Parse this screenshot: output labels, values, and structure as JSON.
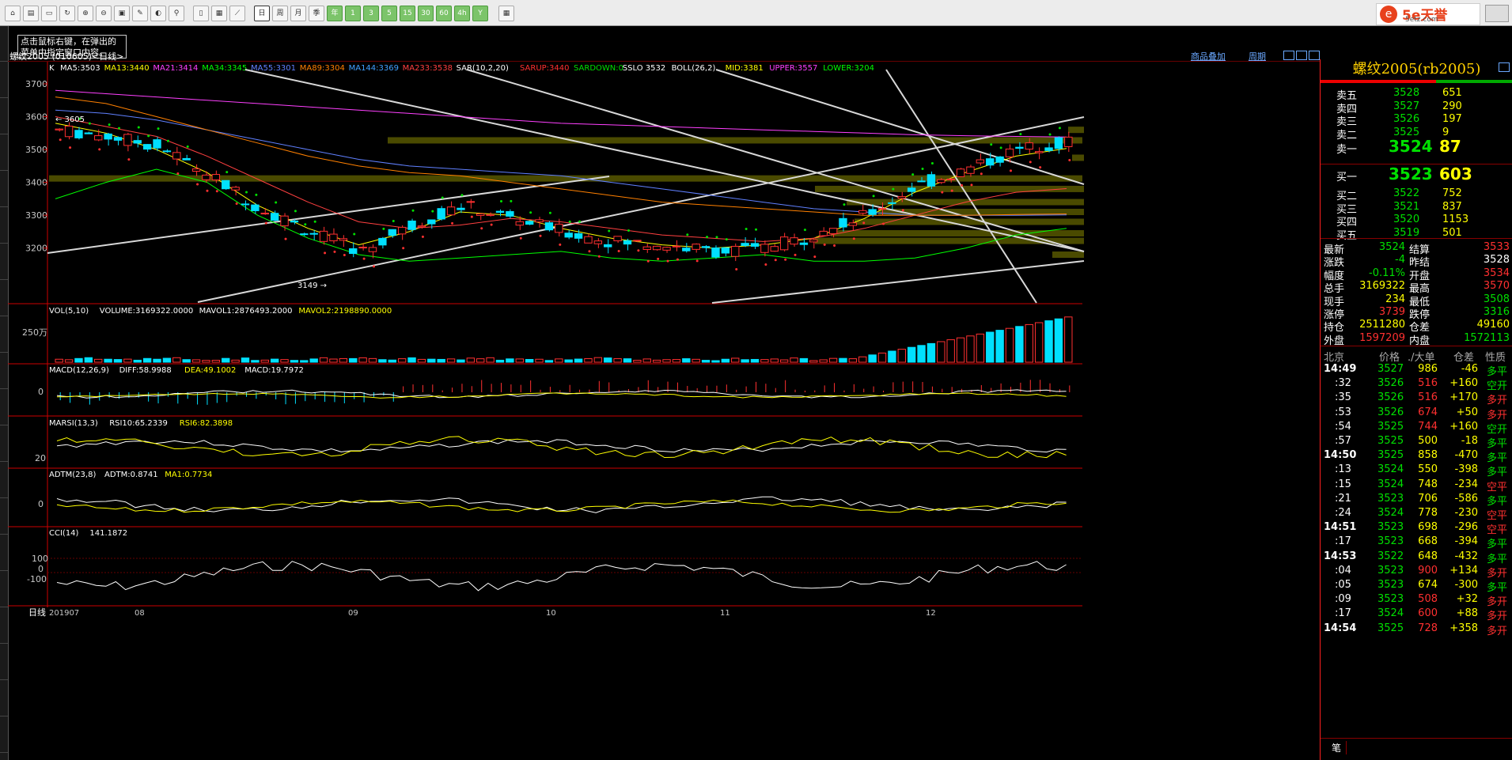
{
  "toolbar": {
    "buttons": [
      "home-icon",
      "open-icon",
      "folder-icon",
      "refresh-icon",
      "zoom-in-icon",
      "zoom-out-icon",
      "draw-icon",
      "pen-icon",
      "palette-icon",
      "filter-icon",
      "tick-icon",
      "table-icon",
      "line-chart-icon",
      "candle-icon",
      "day-icon",
      "week-icon",
      "month-icon",
      "season-icon",
      "year-icon",
      "1min",
      "3min",
      "5min",
      "15min",
      "30min",
      "60min",
      "4hour",
      "year2",
      "calendar-icon"
    ],
    "period_labels": [
      "日",
      "周",
      "月",
      "季",
      "年",
      "1",
      "3",
      "5",
      "15",
      "30",
      "60",
      "4h",
      "Y"
    ],
    "logo_text": "5e天誉",
    "logo_sub": "5etz.com"
  },
  "tooltip": {
    "line1": "点击鼠标右键，在弹出的",
    "line2": "菜单中指定窗口内容。"
  },
  "chart": {
    "symbol_line": "螺纹2005 (010605)<日线>",
    "links": [
      "商品叠加",
      "周期"
    ],
    "ma_header": {
      "k": "K",
      "items": [
        {
          "text": "MA5:3503",
          "color": "#ffffff"
        },
        {
          "text": "MA13:3440",
          "color": "#ffff00"
        },
        {
          "text": "MA21:3414",
          "color": "#ff40ff"
        },
        {
          "text": "MA34:3345",
          "color": "#00ff00"
        },
        {
          "text": "MA55:3301",
          "color": "#6080ff"
        },
        {
          "text": "MA89:3304",
          "color": "#ff8000"
        },
        {
          "text": "MA144:3369",
          "color": "#40a0ff"
        },
        {
          "text": "MA233:3538",
          "color": "#ff4040"
        },
        {
          "text": "SAR(10,2,20)",
          "color": "#ffffff"
        },
        {
          "text": "SARUP:3440",
          "color": "#ff3030"
        },
        {
          "text": "SARDOWN:0",
          "color": "#00e000"
        },
        {
          "text": "SSLO 3532",
          "color": "#ffffff"
        },
        {
          "text": "BOLL(26,2)",
          "color": "#ffffff"
        },
        {
          "text": "MID:3381",
          "color": "#ffff00"
        },
        {
          "text": "UPPER:3557",
          "color": "#ff40ff"
        },
        {
          "text": "LOWER:3204",
          "color": "#00ff00"
        }
      ]
    },
    "price_axis": [
      "3700",
      "3600",
      "3500",
      "3400",
      "3300",
      "3200"
    ],
    "high_label": "3605",
    "low_label": "3149",
    "vol_header": [
      {
        "text": "VOL(5,10)",
        "color": "#ffffff"
      },
      {
        "text": "VOLUME:3169322.0000",
        "color": "#ffffff"
      },
      {
        "text": "MAVOL1:2876493.2000",
        "color": "#ffffff"
      },
      {
        "text": "MAVOL2:2198890.0000",
        "color": "#ffff00"
      }
    ],
    "vol_axis": "250万",
    "macd_header": [
      {
        "text": "MACD(12,26,9)",
        "color": "#ffffff"
      },
      {
        "text": "DIFF:58.9988",
        "color": "#ffffff"
      },
      {
        "text": "DEA:49.1002",
        "color": "#ffff00"
      },
      {
        "text": "MACD:19.7972",
        "color": "#ffffff"
      }
    ],
    "macd_axis": "0",
    "marsi_header": [
      {
        "text": "MARSI(13,3)",
        "color": "#ffffff"
      },
      {
        "text": "RSI10:65.2339",
        "color": "#ffffff"
      },
      {
        "text": "RSI6:82.3898",
        "color": "#ffff00"
      }
    ],
    "marsi_axis": "20",
    "adtm_header": [
      {
        "text": "ADTM(23,8)",
        "color": "#ffffff"
      },
      {
        "text": "ADTM:0.8741",
        "color": "#ffffff"
      },
      {
        "text": "MA1:0.7734",
        "color": "#ffff00"
      }
    ],
    "adtm_axis": "0",
    "cci_header": [
      {
        "text": "CCI(14)",
        "color": "#ffffff"
      },
      {
        "text": "141.1872",
        "color": "#ffffff"
      }
    ],
    "cci_axis": [
      "100",
      "0",
      "-100"
    ],
    "date_axis": [
      "201907",
      "08",
      "09",
      "10",
      "11",
      "12"
    ],
    "period_tab": "日线"
  },
  "quote": {
    "title": "螺纹2005(rb2005)",
    "asks": [
      {
        "label": "卖五",
        "price": "3528",
        "vol": "651"
      },
      {
        "label": "卖四",
        "price": "3527",
        "vol": "290"
      },
      {
        "label": "卖三",
        "price": "3526",
        "vol": "197"
      },
      {
        "label": "卖二",
        "price": "3525",
        "vol": "9"
      },
      {
        "label": "卖一",
        "price": "3524",
        "vol": "87"
      }
    ],
    "bids": [
      {
        "label": "买一",
        "price": "3523",
        "vol": "603"
      },
      {
        "label": "买二",
        "price": "3522",
        "vol": "752"
      },
      {
        "label": "买三",
        "price": "3521",
        "vol": "837"
      },
      {
        "label": "买四",
        "price": "3520",
        "vol": "1153"
      },
      {
        "label": "买五",
        "price": "3519",
        "vol": "501"
      }
    ],
    "stats": [
      {
        "l1": "最新",
        "v1": "3524",
        "c1": "#00e000",
        "l2": "结算",
        "v2": "3533",
        "c2": "#ff3030"
      },
      {
        "l1": "涨跌",
        "v1": "-4",
        "c1": "#00e000",
        "l2": "昨结",
        "v2": "3528",
        "c2": "#ffffff"
      },
      {
        "l1": "幅度",
        "v1": "-0.11%",
        "c1": "#00e000",
        "l2": "开盘",
        "v2": "3534",
        "c2": "#ff3030"
      },
      {
        "l1": "总手",
        "v1": "3169322",
        "c1": "#ffff00",
        "l2": "最高",
        "v2": "3570",
        "c2": "#ff3030"
      },
      {
        "l1": "现手",
        "v1": "234",
        "c1": "#ffff00",
        "l2": "最低",
        "v2": "3508",
        "c2": "#00e000"
      },
      {
        "l1": "涨停",
        "v1": "3739",
        "c1": "#ff3030",
        "l2": "跌停",
        "v2": "3316",
        "c2": "#00e000"
      },
      {
        "l1": "持仓",
        "v1": "2511280",
        "c1": "#ffff00",
        "l2": "仓差",
        "v2": "49160",
        "c2": "#ffff00"
      },
      {
        "l1": "外盘",
        "v1": "1597209",
        "c1": "#ff3030",
        "l2": "内盘",
        "v2": "1572113",
        "c2": "#00e000"
      }
    ],
    "tick_header": {
      "c1": "北京",
      "c2": "价格",
      "c3": "./大单",
      "c4": "仓差",
      "c5": "性质"
    },
    "ticks": [
      {
        "time": "14:49",
        "major": true,
        "price": "3527",
        "vol": "986",
        "diff": "-46",
        "type": "多平"
      },
      {
        "time": ":32",
        "major": false,
        "price": "3526",
        "vol": "516",
        "diff": "+160",
        "type": "空开"
      },
      {
        "time": ":35",
        "major": false,
        "price": "3526",
        "vol": "516",
        "diff": "+170",
        "type": "多开"
      },
      {
        "time": ":53",
        "major": false,
        "price": "3526",
        "vol": "674",
        "diff": "+50",
        "type": "多开"
      },
      {
        "time": ":54",
        "major": false,
        "price": "3525",
        "vol": "744",
        "diff": "+160",
        "type": "空开"
      },
      {
        "time": ":57",
        "major": false,
        "price": "3525",
        "vol": "500",
        "diff": "-18",
        "type": "多平"
      },
      {
        "time": "14:50",
        "major": true,
        "price": "3525",
        "vol": "858",
        "diff": "-470",
        "type": "多平"
      },
      {
        "time": ":13",
        "major": false,
        "price": "3524",
        "vol": "550",
        "diff": "-398",
        "type": "多平"
      },
      {
        "time": ":15",
        "major": false,
        "price": "3524",
        "vol": "748",
        "diff": "-234",
        "type": "空平"
      },
      {
        "time": ":21",
        "major": false,
        "price": "3523",
        "vol": "706",
        "diff": "-586",
        "type": "多平"
      },
      {
        "time": ":24",
        "major": false,
        "price": "3524",
        "vol": "778",
        "diff": "-230",
        "type": "空平"
      },
      {
        "time": "14:51",
        "major": true,
        "price": "3523",
        "vol": "698",
        "diff": "-296",
        "type": "空平"
      },
      {
        "time": ":17",
        "major": false,
        "price": "3523",
        "vol": "668",
        "diff": "-394",
        "type": "多平"
      },
      {
        "time": "14:53",
        "major": true,
        "price": "3522",
        "vol": "648",
        "diff": "-432",
        "type": "多平"
      },
      {
        "time": ":04",
        "major": false,
        "price": "3523",
        "vol": "900",
        "diff": "+134",
        "type": "多开"
      },
      {
        "time": ":05",
        "major": false,
        "price": "3523",
        "vol": "674",
        "diff": "-300",
        "type": "多平"
      },
      {
        "time": ":09",
        "major": false,
        "price": "3523",
        "vol": "508",
        "diff": "+32",
        "type": "多开"
      },
      {
        "time": ":17",
        "major": false,
        "price": "3524",
        "vol": "600",
        "diff": "+88",
        "type": "多开"
      },
      {
        "time": "14:54",
        "major": true,
        "price": "3525",
        "vol": "728",
        "diff": "+358",
        "type": "多开"
      }
    ],
    "bottom_tab": "笔"
  },
  "chart_data": {
    "type": "line",
    "title": "螺纹2005 (010605)<日线>",
    "xlabel": "",
    "ylabel": "",
    "categories": [
      "201907",
      "08",
      "09",
      "10",
      "11",
      "12"
    ],
    "ylim": [
      3100,
      3750
    ],
    "series": [
      {
        "name": "K",
        "values": [
          3560,
          3540,
          3510,
          3420,
          3320,
          3250,
          3190,
          3270,
          3330,
          3290,
          3250,
          3220,
          3210,
          3190,
          3200,
          3240,
          3300,
          3390,
          3440,
          3500,
          3524
        ]
      },
      {
        "name": "MA5:3503",
        "values": [
          3580,
          3550,
          3500,
          3430,
          3330,
          3260,
          3210,
          3250,
          3310,
          3300,
          3260,
          3230,
          3210,
          3200,
          3210,
          3230,
          3290,
          3370,
          3430,
          3480,
          3503
        ]
      },
      {
        "name": "MID:3381",
        "values": [
          3600,
          3570,
          3540,
          3480,
          3410,
          3340,
          3280,
          3260,
          3270,
          3290,
          3280,
          3260,
          3240,
          3230,
          3220,
          3230,
          3260,
          3300,
          3340,
          3370,
          3381
        ]
      },
      {
        "name": "MA233:3538",
        "values": [
          3680,
          3670,
          3660,
          3650,
          3640,
          3630,
          3620,
          3610,
          3600,
          3590,
          3580,
          3575,
          3570,
          3565,
          3560,
          3555,
          3550,
          3545,
          3542,
          3540,
          3538
        ]
      }
    ]
  }
}
